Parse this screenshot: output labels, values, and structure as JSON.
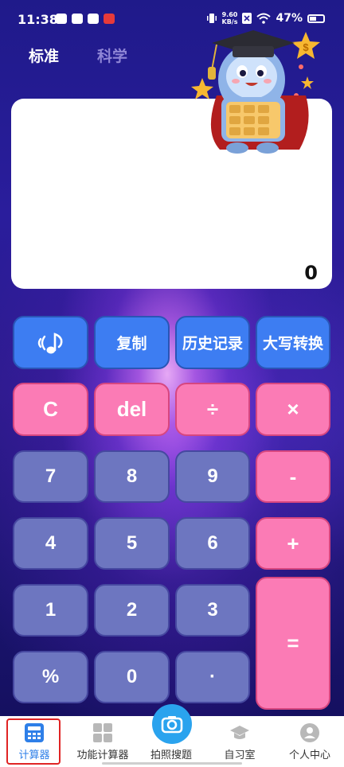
{
  "status_bar": {
    "time": "11:38",
    "net_speed_value": "9.60",
    "net_speed_unit": "KB/s",
    "battery": "47%"
  },
  "tabs": {
    "standard": "标准",
    "scientific": "科学"
  },
  "display": {
    "value": "0"
  },
  "keys": {
    "copy": "复制",
    "history": "历史记录",
    "uppercase_convert": "大写转换",
    "clear": "C",
    "delete": "del",
    "divide": "÷",
    "multiply": "×",
    "seven": "7",
    "eight": "8",
    "nine": "9",
    "minus": "-",
    "four": "4",
    "five": "5",
    "six": "6",
    "plus": "+",
    "one": "1",
    "two": "2",
    "three": "3",
    "equals": "=",
    "percent": "%",
    "zero": "0",
    "dot": "·"
  },
  "nav": {
    "calculator": "计算器",
    "function_calculator": "功能计算器",
    "photo_search": "拍照搜题",
    "study_room": "自习室",
    "personal_center": "个人中心"
  },
  "colors": {
    "key_blue": "#3d7df2",
    "key_pink": "#fb7bb5",
    "key_grey": "#6d76c0",
    "camera_blue": "#2aa3ee",
    "active_outline": "#e02424"
  }
}
